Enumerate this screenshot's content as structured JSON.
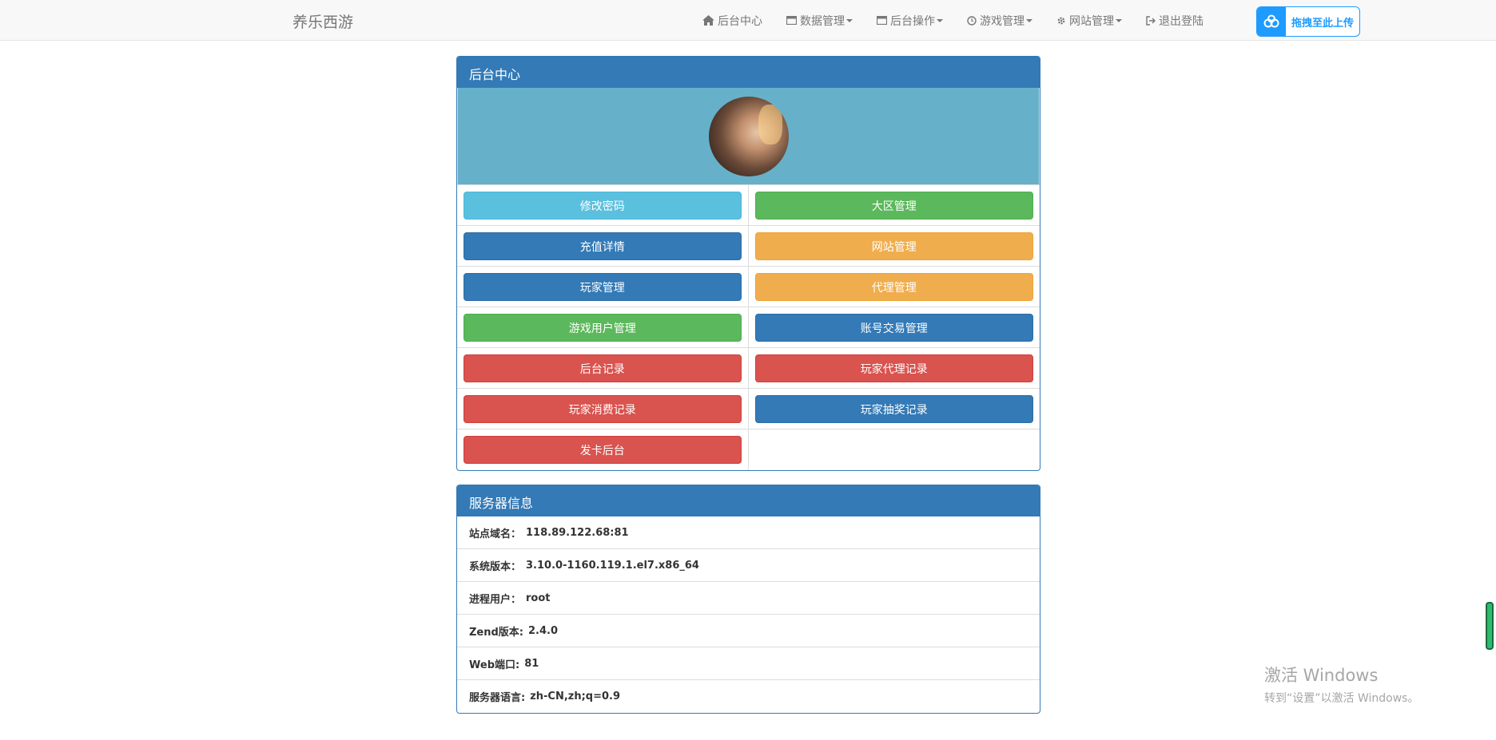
{
  "navbar": {
    "brand": "养乐西游",
    "items": [
      {
        "label": "后台中心",
        "icon": "home-icon",
        "dropdown": false
      },
      {
        "label": "数据管理",
        "icon": "window-icon",
        "dropdown": true
      },
      {
        "label": "后台操作",
        "icon": "window-icon",
        "dropdown": true
      },
      {
        "label": "游戏管理",
        "icon": "clock-icon",
        "dropdown": true
      },
      {
        "label": "网站管理",
        "icon": "gear-icon",
        "dropdown": true
      },
      {
        "label": "退出登陆",
        "icon": "logout-icon",
        "dropdown": false
      }
    ],
    "upload_label": "拖拽至此上传"
  },
  "admin_panel": {
    "title": "后台中心",
    "buttons": [
      {
        "label": "修改密码",
        "style": "info"
      },
      {
        "label": "大区管理",
        "style": "success"
      },
      {
        "label": "充值详情",
        "style": "primary"
      },
      {
        "label": "网站管理",
        "style": "warning"
      },
      {
        "label": "玩家管理",
        "style": "primary"
      },
      {
        "label": "代理管理",
        "style": "warning"
      },
      {
        "label": "游戏用户管理",
        "style": "success"
      },
      {
        "label": "账号交易管理",
        "style": "primary"
      },
      {
        "label": "后台记录",
        "style": "danger"
      },
      {
        "label": "玩家代理记录",
        "style": "danger"
      },
      {
        "label": "玩家消费记录",
        "style": "danger"
      },
      {
        "label": "玩家抽奖记录",
        "style": "primary"
      },
      {
        "label": "发卡后台",
        "style": "danger"
      }
    ]
  },
  "server_panel": {
    "title": "服务器信息",
    "rows": [
      {
        "label": "站点域名：",
        "value": "118.89.122.68:81"
      },
      {
        "label": "系统版本：",
        "value": "3.10.0-1160.119.1.el7.x86_64"
      },
      {
        "label": "进程用户：",
        "value": "root"
      },
      {
        "label": "Zend版本:",
        "value": "2.4.0"
      },
      {
        "label": "Web端口:",
        "value": "81"
      },
      {
        "label": "服务器语言:",
        "value": "zh-CN,zh;q=0.9"
      }
    ]
  },
  "watermark": {
    "line1": "激活 Windows",
    "line2": "转到“设置”以激活 Windows。"
  },
  "colors": {
    "primary": "#337ab7",
    "info": "#5bc0de",
    "success": "#5cb85c",
    "warning": "#f0ad4e",
    "danger": "#d9534f",
    "avatar_bg": "#66b1c9"
  }
}
